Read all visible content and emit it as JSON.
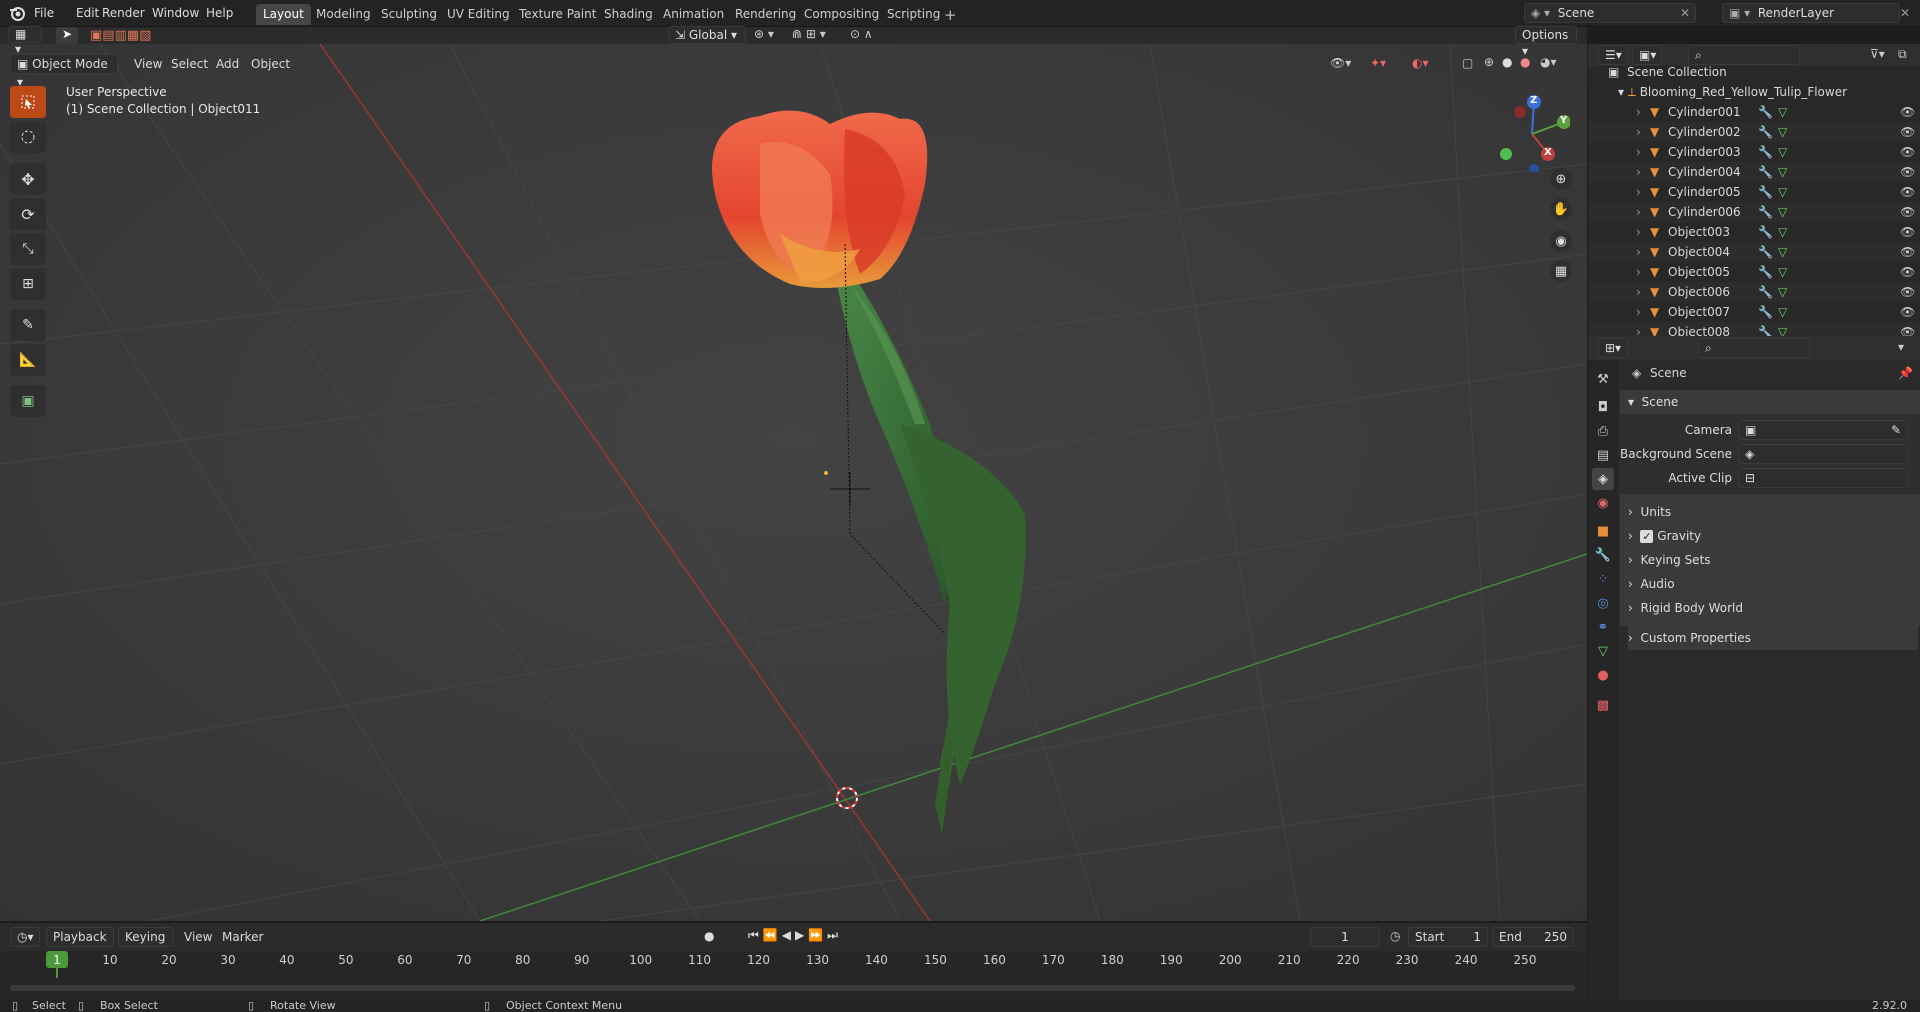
{
  "menu": [
    "File",
    "Edit",
    "Render",
    "Window",
    "Help"
  ],
  "workspaces": [
    "Layout",
    "Modeling",
    "Sculpting",
    "UV Editing",
    "Texture Paint",
    "Shading",
    "Animation",
    "Rendering",
    "Compositing",
    "Scripting"
  ],
  "active_workspace": "Layout",
  "scene_name": "Scene",
  "renderlayer_name": "RenderLayer",
  "viewport": {
    "mode": "Object Mode",
    "header_menus": [
      "View",
      "Select",
      "Add",
      "Object"
    ],
    "transform_orientation": "Global",
    "options_label": "Options",
    "perspective_label": "User Perspective",
    "collection_label": "(1) Scene Collection | Object011",
    "gizmo_axes": {
      "x": "X",
      "y": "Y",
      "z": "Z"
    }
  },
  "outliner": {
    "root": "Scene Collection",
    "parent": "Blooming_Red_Yellow_Tulip_Flower",
    "items": [
      "Cylinder001",
      "Cylinder002",
      "Cylinder003",
      "Cylinder004",
      "Cylinder005",
      "Cylinder006",
      "Object003",
      "Object004",
      "Object005",
      "Object006",
      "Object007",
      "Object008"
    ]
  },
  "properties": {
    "header": "Scene",
    "panel_title": "Scene",
    "camera_label": "Camera",
    "background_scene_label": "Background Scene",
    "active_clip_label": "Active Clip",
    "sections": [
      "Units",
      "Gravity",
      "Keying Sets",
      "Audio",
      "Rigid Body World",
      "Custom Properties"
    ],
    "gravity_checked": true
  },
  "timeline": {
    "menus": [
      "Playback",
      "Keying",
      "View",
      "Marker"
    ],
    "current_frame": "1",
    "start_label": "Start",
    "start_value": "1",
    "end_label": "End",
    "end_value": "250",
    "ticks": [
      "1",
      "10",
      "20",
      "30",
      "40",
      "50",
      "60",
      "70",
      "80",
      "90",
      "100",
      "110",
      "120",
      "130",
      "140",
      "150",
      "160",
      "170",
      "180",
      "190",
      "200",
      "210",
      "220",
      "230",
      "240",
      "250"
    ]
  },
  "statusbar": {
    "select": "Select",
    "box_select": "Box Select",
    "rotate_view": "Rotate View",
    "context_menu": "Object Context Menu",
    "version": "2.92.0"
  },
  "colors": {
    "accent": "#bb4a17",
    "x_axis": "#c0403f",
    "y_axis": "#5aa03c",
    "z_axis": "#3a6fd8",
    "viewport_bg": "#3c3c3c"
  }
}
